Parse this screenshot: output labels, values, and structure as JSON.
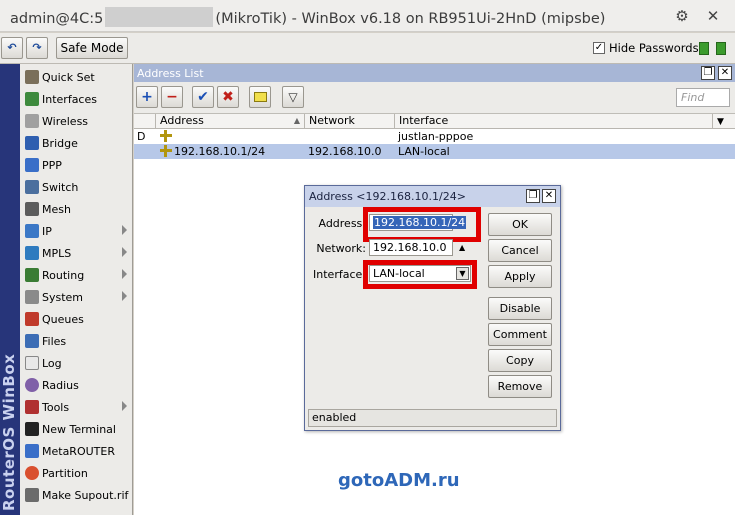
{
  "titlebar": {
    "prefix": "admin@4C:5",
    "suffix": "(MikroTik) - WinBox v6.18 on RB951Ui-2HnD (mipsbe)",
    "settings_icon": "⚙",
    "close_icon": "✕"
  },
  "toolbar": {
    "undo_icon": "↶",
    "redo_icon": "↷",
    "safe_mode_label": "Safe Mode",
    "hide_passwords_label": "Hide Passwords",
    "hide_passwords_checked": "✓"
  },
  "brand": "RouterOS WinBox",
  "sidebar": {
    "items": [
      {
        "label": "Quick Set",
        "icon_color": "#7a6f5a"
      },
      {
        "label": "Interfaces",
        "icon_color": "#3d8a3d"
      },
      {
        "label": "Wireless",
        "icon_color": "#a0a0a0"
      },
      {
        "label": "Bridge",
        "icon_color": "#2f5fb0"
      },
      {
        "label": "PPP",
        "icon_color": "#3a6fc8"
      },
      {
        "label": "Switch",
        "icon_color": "#4b6f9e"
      },
      {
        "label": "Mesh",
        "icon_color": "#5c5c5c"
      },
      {
        "label": "IP",
        "icon_color": "#3b78c6"
      },
      {
        "label": "MPLS",
        "icon_color": "#2e7bbf"
      },
      {
        "label": "Routing",
        "icon_color": "#3a7c34"
      },
      {
        "label": "System",
        "icon_color": "#8a8a8a"
      },
      {
        "label": "Queues",
        "icon_color": "#c03a2b"
      },
      {
        "label": "Files",
        "icon_color": "#3c6db5"
      },
      {
        "label": "Log",
        "icon_color": "#e8e8e8"
      },
      {
        "label": "Radius",
        "icon_color": "#8060a8"
      },
      {
        "label": "Tools",
        "icon_color": "#b03030"
      },
      {
        "label": "New Terminal",
        "icon_color": "#222222"
      },
      {
        "label": "MetaROUTER",
        "icon_color": "#3a6fc8"
      },
      {
        "label": "Partition",
        "icon_color": "#d9502f"
      },
      {
        "label": "Make Supout.rif",
        "icon_color": "#6b6b6b"
      }
    ]
  },
  "address_list": {
    "title": "Address List",
    "find_placeholder": "Find",
    "tools": {
      "add": "+",
      "remove": "−",
      "enable": "✔",
      "disable": "✖",
      "comment": "",
      "filter": "▽"
    },
    "columns": [
      "Address",
      "Network",
      "Interface"
    ],
    "rows": [
      {
        "flag": "D",
        "address": "",
        "network": "",
        "interface": "justlan-pppoe"
      },
      {
        "flag": "",
        "address": "192.168.10.1/24",
        "network": "192.168.10.0",
        "interface": "LAN-local"
      }
    ]
  },
  "dialog": {
    "title": "Address <192.168.10.1/24>",
    "address_label": "Address:",
    "address_value": "192.168.10.1/24",
    "network_label": "Network:",
    "network_value": "192.168.10.0",
    "interface_label": "Interface:",
    "interface_value": "LAN-local",
    "buttons": {
      "ok": "OK",
      "cancel": "Cancel",
      "apply": "Apply",
      "disable": "Disable",
      "comment": "Comment",
      "copy": "Copy",
      "remove": "Remove"
    },
    "status": "enabled"
  },
  "colors": {
    "highlight": "#e00000",
    "brand_strip": "#27357a",
    "selected_row": "#b7c8e8",
    "watermark": "#2e67b8"
  },
  "watermark": "gotoADM.ru"
}
